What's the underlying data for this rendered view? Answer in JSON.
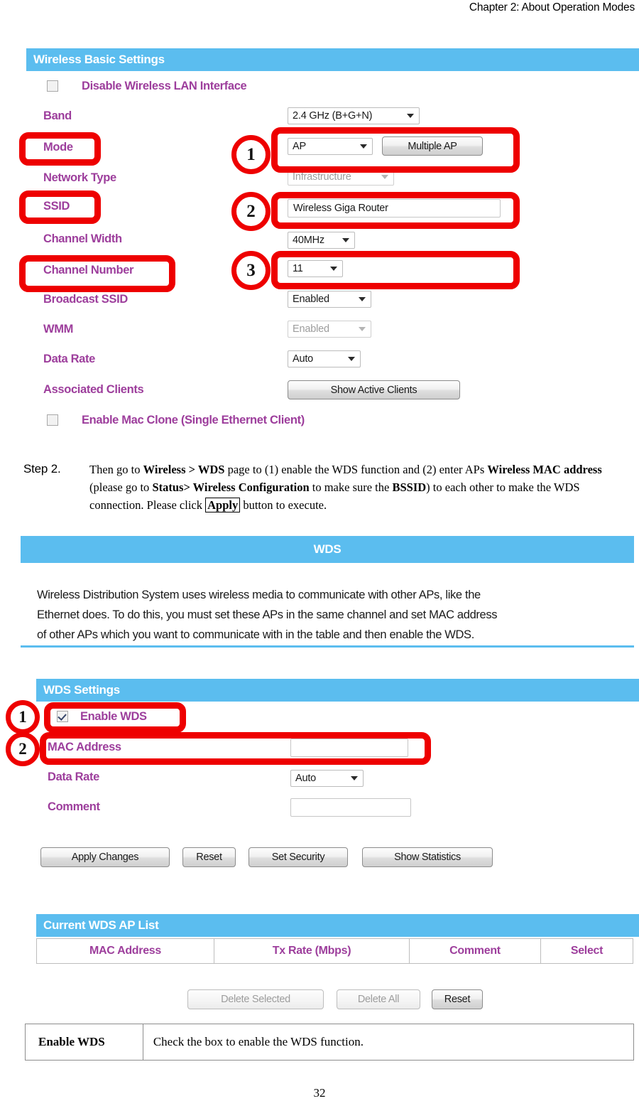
{
  "document": {
    "running_header": "Chapter 2: About Operation Modes",
    "page_number": "32"
  },
  "wireless_basic_settings": {
    "panel_title": "Wireless Basic Settings",
    "disable_wlan": {
      "label": "Disable Wireless LAN Interface",
      "checked": false
    },
    "rows": [
      {
        "label": "Band",
        "value": "2.4 GHz (B+G+N)",
        "control": "select"
      },
      {
        "label": "Mode",
        "value": "AP",
        "control": "select"
      },
      {
        "label": "Network Type",
        "value": "Infrastructure",
        "control": "select-disabled"
      },
      {
        "label": "SSID",
        "value": "Wireless Giga Router",
        "control": "text"
      },
      {
        "label": "Channel Width",
        "value": "40MHz",
        "control": "select"
      },
      {
        "label": "Channel Number",
        "value": "11",
        "control": "select"
      },
      {
        "label": "Broadcast SSID",
        "value": "Enabled",
        "control": "select"
      },
      {
        "label": "WMM",
        "value": "Enabled",
        "control": "select-disabled"
      },
      {
        "label": "Data Rate",
        "value": "Auto",
        "control": "select"
      },
      {
        "label": "Associated Clients",
        "value": "Show Active Clients",
        "control": "button"
      }
    ],
    "multiple_ap_button": "Multiple AP",
    "mac_clone": {
      "label": "Enable Mac Clone (Single Ethernet Client)",
      "checked": false
    },
    "annotations": [
      "1",
      "2",
      "3"
    ]
  },
  "step2": {
    "label": "Step 2.",
    "line1_a": "Then go to ",
    "line1_b": "Wireless > WDS",
    "line1_c": " page to (1) enable the WDS function and (2) enter APs",
    "line2_a": "Wireless MAC address",
    "line2_b": " (please go to ",
    "line2_c": "Status> Wireless  Configuration",
    "line2_d": " to make sure the",
    "line3_a": "BSSID",
    "line3_b": ") to each other to make the WDS connection. Please click ",
    "line3_c": "Apply",
    "line3_d": " button to execute."
  },
  "wds_panel": {
    "panel_title": "WDS",
    "description_line1": "Wireless Distribution System uses wireless media to communicate with other APs, like the",
    "description_line2": "Ethernet does. To do this, you must set these APs in the same channel and set MAC address",
    "description_line3": "of other APs which you want to communicate with in the table and then enable the WDS."
  },
  "wds_settings": {
    "panel_title": "WDS Settings",
    "enable_wds": {
      "label": "Enable WDS",
      "checked": true
    },
    "rows": [
      {
        "label": "MAC Address",
        "value": "",
        "control": "text"
      },
      {
        "label": "Data Rate",
        "value": "Auto",
        "control": "select"
      },
      {
        "label": "Comment",
        "value": "",
        "control": "text"
      }
    ],
    "buttons": [
      "Apply Changes",
      "Reset",
      "Set Security",
      "Show Statistics"
    ],
    "annotations": [
      "1",
      "2"
    ]
  },
  "current_wds_ap_list": {
    "panel_title": "Current WDS AP List",
    "columns": [
      "MAC Address",
      "Tx Rate (Mbps)",
      "Comment",
      "Select"
    ],
    "rows": [],
    "buttons": [
      {
        "label": "Delete Selected",
        "enabled": false
      },
      {
        "label": "Delete All",
        "enabled": false
      },
      {
        "label": "Reset",
        "enabled": true
      }
    ]
  },
  "description_table": {
    "rows": [
      {
        "term": "Enable WDS",
        "definition": "Check the box to enable the WDS function."
      }
    ]
  },
  "colors": {
    "panel_blue": "#5bbdef",
    "label_purple": "#9d3e9c",
    "annotation_red": "#ee0000"
  }
}
